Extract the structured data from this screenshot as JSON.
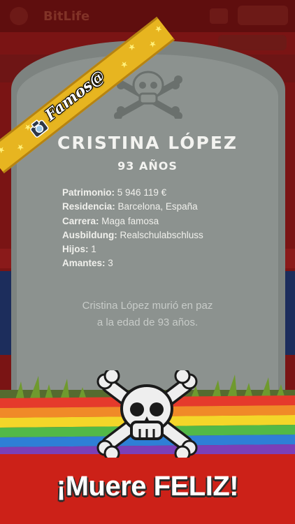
{
  "app": {
    "brand": "BitLife"
  },
  "badge": {
    "label": "Famos@"
  },
  "person": {
    "name": "CRISTINA LÓPEZ",
    "age": "93 AÑOS"
  },
  "stats": [
    {
      "key": "Patrimonio:",
      "value": "5 946 119 €"
    },
    {
      "key": "Residencia:",
      "value": "Barcelona, España"
    },
    {
      "key": "Carrera:",
      "value": "Maga famosa"
    },
    {
      "key": "Ausbildung:",
      "value": "Realschulabschluss"
    },
    {
      "key": "Hijos:",
      "value": "1"
    },
    {
      "key": "Amantes:",
      "value": "3"
    }
  ],
  "epitaph": {
    "line1": "Cristina López murió en paz",
    "line2": "a la edad de 93 años."
  },
  "footer": {
    "slogan": "¡Muere FELIZ!"
  },
  "colors": {
    "tombstone": "#8c928f",
    "ribbon": "#e7b520",
    "background_red": "#cc2118"
  }
}
